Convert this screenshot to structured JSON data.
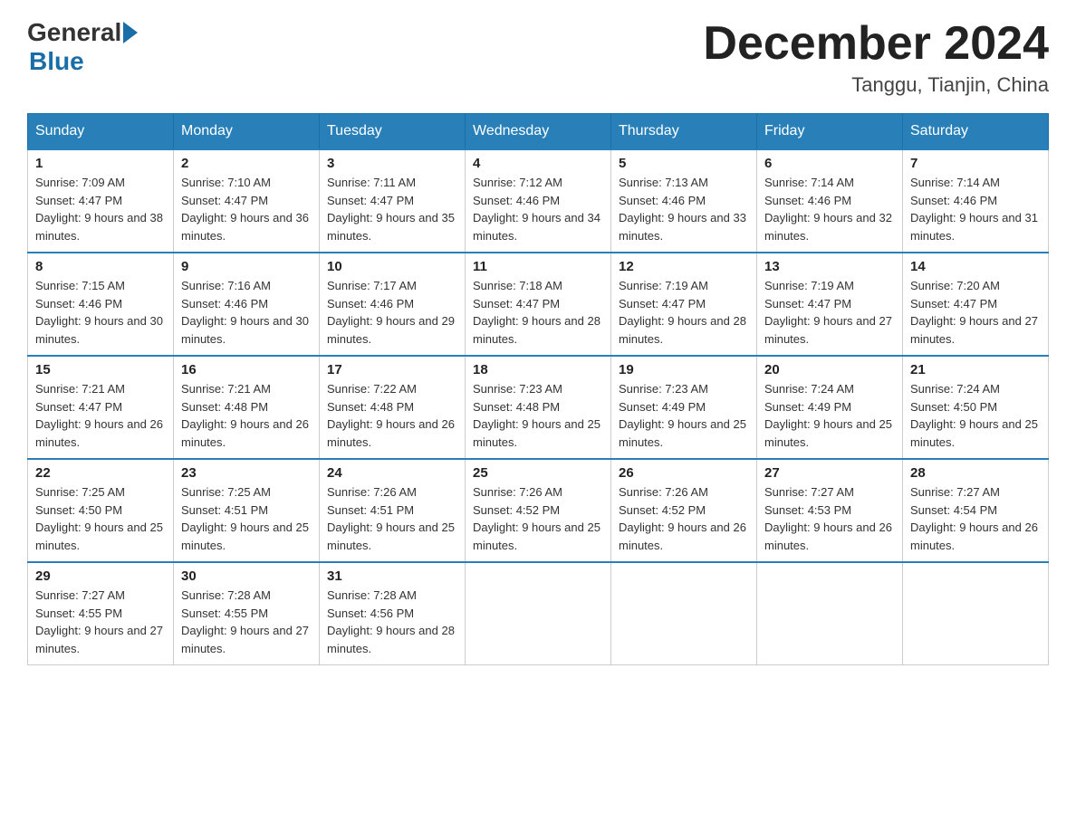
{
  "header": {
    "logo_general": "General",
    "logo_blue": "Blue",
    "title": "December 2024",
    "subtitle": "Tanggu, Tianjin, China"
  },
  "calendar": {
    "days_of_week": [
      "Sunday",
      "Monday",
      "Tuesday",
      "Wednesday",
      "Thursday",
      "Friday",
      "Saturday"
    ],
    "weeks": [
      [
        {
          "day": "1",
          "sunrise": "Sunrise: 7:09 AM",
          "sunset": "Sunset: 4:47 PM",
          "daylight": "Daylight: 9 hours and 38 minutes."
        },
        {
          "day": "2",
          "sunrise": "Sunrise: 7:10 AM",
          "sunset": "Sunset: 4:47 PM",
          "daylight": "Daylight: 9 hours and 36 minutes."
        },
        {
          "day": "3",
          "sunrise": "Sunrise: 7:11 AM",
          "sunset": "Sunset: 4:47 PM",
          "daylight": "Daylight: 9 hours and 35 minutes."
        },
        {
          "day": "4",
          "sunrise": "Sunrise: 7:12 AM",
          "sunset": "Sunset: 4:46 PM",
          "daylight": "Daylight: 9 hours and 34 minutes."
        },
        {
          "day": "5",
          "sunrise": "Sunrise: 7:13 AM",
          "sunset": "Sunset: 4:46 PM",
          "daylight": "Daylight: 9 hours and 33 minutes."
        },
        {
          "day": "6",
          "sunrise": "Sunrise: 7:14 AM",
          "sunset": "Sunset: 4:46 PM",
          "daylight": "Daylight: 9 hours and 32 minutes."
        },
        {
          "day": "7",
          "sunrise": "Sunrise: 7:14 AM",
          "sunset": "Sunset: 4:46 PM",
          "daylight": "Daylight: 9 hours and 31 minutes."
        }
      ],
      [
        {
          "day": "8",
          "sunrise": "Sunrise: 7:15 AM",
          "sunset": "Sunset: 4:46 PM",
          "daylight": "Daylight: 9 hours and 30 minutes."
        },
        {
          "day": "9",
          "sunrise": "Sunrise: 7:16 AM",
          "sunset": "Sunset: 4:46 PM",
          "daylight": "Daylight: 9 hours and 30 minutes."
        },
        {
          "day": "10",
          "sunrise": "Sunrise: 7:17 AM",
          "sunset": "Sunset: 4:46 PM",
          "daylight": "Daylight: 9 hours and 29 minutes."
        },
        {
          "day": "11",
          "sunrise": "Sunrise: 7:18 AM",
          "sunset": "Sunset: 4:47 PM",
          "daylight": "Daylight: 9 hours and 28 minutes."
        },
        {
          "day": "12",
          "sunrise": "Sunrise: 7:19 AM",
          "sunset": "Sunset: 4:47 PM",
          "daylight": "Daylight: 9 hours and 28 minutes."
        },
        {
          "day": "13",
          "sunrise": "Sunrise: 7:19 AM",
          "sunset": "Sunset: 4:47 PM",
          "daylight": "Daylight: 9 hours and 27 minutes."
        },
        {
          "day": "14",
          "sunrise": "Sunrise: 7:20 AM",
          "sunset": "Sunset: 4:47 PM",
          "daylight": "Daylight: 9 hours and 27 minutes."
        }
      ],
      [
        {
          "day": "15",
          "sunrise": "Sunrise: 7:21 AM",
          "sunset": "Sunset: 4:47 PM",
          "daylight": "Daylight: 9 hours and 26 minutes."
        },
        {
          "day": "16",
          "sunrise": "Sunrise: 7:21 AM",
          "sunset": "Sunset: 4:48 PM",
          "daylight": "Daylight: 9 hours and 26 minutes."
        },
        {
          "day": "17",
          "sunrise": "Sunrise: 7:22 AM",
          "sunset": "Sunset: 4:48 PM",
          "daylight": "Daylight: 9 hours and 26 minutes."
        },
        {
          "day": "18",
          "sunrise": "Sunrise: 7:23 AM",
          "sunset": "Sunset: 4:48 PM",
          "daylight": "Daylight: 9 hours and 25 minutes."
        },
        {
          "day": "19",
          "sunrise": "Sunrise: 7:23 AM",
          "sunset": "Sunset: 4:49 PM",
          "daylight": "Daylight: 9 hours and 25 minutes."
        },
        {
          "day": "20",
          "sunrise": "Sunrise: 7:24 AM",
          "sunset": "Sunset: 4:49 PM",
          "daylight": "Daylight: 9 hours and 25 minutes."
        },
        {
          "day": "21",
          "sunrise": "Sunrise: 7:24 AM",
          "sunset": "Sunset: 4:50 PM",
          "daylight": "Daylight: 9 hours and 25 minutes."
        }
      ],
      [
        {
          "day": "22",
          "sunrise": "Sunrise: 7:25 AM",
          "sunset": "Sunset: 4:50 PM",
          "daylight": "Daylight: 9 hours and 25 minutes."
        },
        {
          "day": "23",
          "sunrise": "Sunrise: 7:25 AM",
          "sunset": "Sunset: 4:51 PM",
          "daylight": "Daylight: 9 hours and 25 minutes."
        },
        {
          "day": "24",
          "sunrise": "Sunrise: 7:26 AM",
          "sunset": "Sunset: 4:51 PM",
          "daylight": "Daylight: 9 hours and 25 minutes."
        },
        {
          "day": "25",
          "sunrise": "Sunrise: 7:26 AM",
          "sunset": "Sunset: 4:52 PM",
          "daylight": "Daylight: 9 hours and 25 minutes."
        },
        {
          "day": "26",
          "sunrise": "Sunrise: 7:26 AM",
          "sunset": "Sunset: 4:52 PM",
          "daylight": "Daylight: 9 hours and 26 minutes."
        },
        {
          "day": "27",
          "sunrise": "Sunrise: 7:27 AM",
          "sunset": "Sunset: 4:53 PM",
          "daylight": "Daylight: 9 hours and 26 minutes."
        },
        {
          "day": "28",
          "sunrise": "Sunrise: 7:27 AM",
          "sunset": "Sunset: 4:54 PM",
          "daylight": "Daylight: 9 hours and 26 minutes."
        }
      ],
      [
        {
          "day": "29",
          "sunrise": "Sunrise: 7:27 AM",
          "sunset": "Sunset: 4:55 PM",
          "daylight": "Daylight: 9 hours and 27 minutes."
        },
        {
          "day": "30",
          "sunrise": "Sunrise: 7:28 AM",
          "sunset": "Sunset: 4:55 PM",
          "daylight": "Daylight: 9 hours and 27 minutes."
        },
        {
          "day": "31",
          "sunrise": "Sunrise: 7:28 AM",
          "sunset": "Sunset: 4:56 PM",
          "daylight": "Daylight: 9 hours and 28 minutes."
        },
        null,
        null,
        null,
        null
      ]
    ]
  }
}
